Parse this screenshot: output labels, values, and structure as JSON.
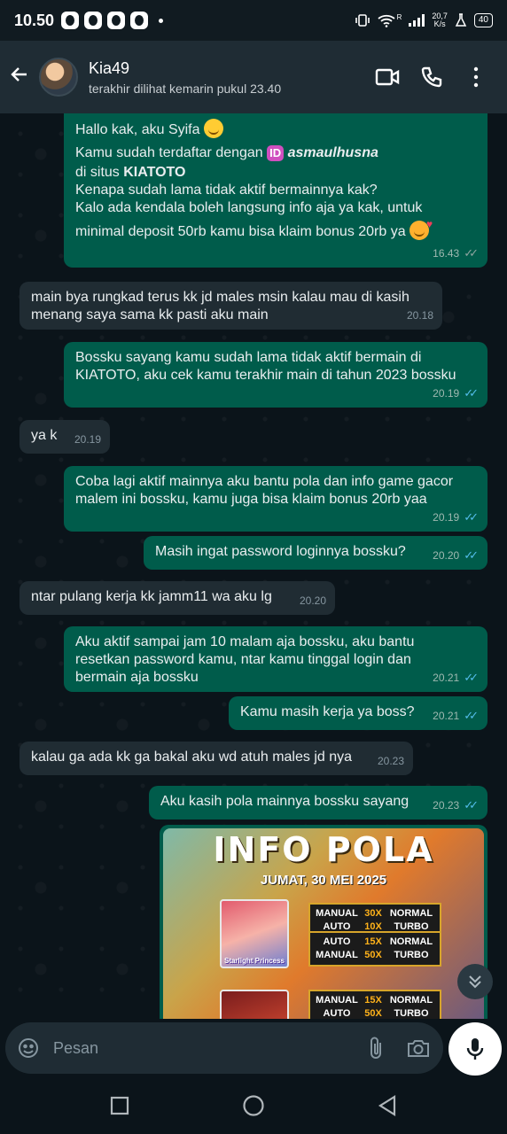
{
  "status_bar": {
    "time": "10.50",
    "network_speed": "20,7",
    "network_unit": "K/s",
    "wifi_label": "R",
    "battery": "40"
  },
  "header": {
    "contact_name": "Kia49",
    "last_seen": "terakhir dilihat kemarin pukul 23.40"
  },
  "messages": [
    {
      "direction": "out",
      "lines": [
        "Hallo kak, aku Syifa",
        "Kamu sudah terdaftar dengan",
        "asmaulhusna",
        "di situs",
        "KIATOTO",
        "Kenapa sudah lama tidak aktif bermainnya kak?",
        "Kalo ada kendala boleh langsung info aja ya kak, untuk",
        "minimal deposit 50rb kamu bisa klaim bonus 20rb ya"
      ],
      "id_tag": "ID",
      "time": "16.43",
      "read": false
    },
    {
      "direction": "in",
      "text": "main bya rungkad terus kk jd males msin kalau mau di kasih menang saya sama kk pasti aku main",
      "time": "20.18"
    },
    {
      "direction": "out",
      "text": "Bossku sayang kamu sudah lama tidak aktif bermain di KIATOTO, aku cek kamu terakhir main di tahun 2023 bossku",
      "time": "20.19",
      "read": true
    },
    {
      "direction": "in",
      "text": "ya k",
      "time": "20.19"
    },
    {
      "direction": "out",
      "text": "Coba lagi aktif mainnya aku bantu pola dan info game gacor malem ini bossku, kamu juga bisa klaim bonus 20rb yaa",
      "time": "20.19",
      "read": true
    },
    {
      "direction": "out",
      "text": "Masih ingat password loginnya bossku?",
      "time": "20.20",
      "read": true
    },
    {
      "direction": "in",
      "text": "ntar pulang kerja kk jamm11 wa aku lg",
      "time": "20.20"
    },
    {
      "direction": "out",
      "text": "Aku aktif sampai jam 10 malam aja bossku, aku bantu resetkan password kamu, ntar kamu tinggal login dan bermain aja bossku",
      "time": "20.21",
      "read": true
    },
    {
      "direction": "out",
      "text": "Kamu masih kerja ya boss?",
      "time": "20.21",
      "read": true
    },
    {
      "direction": "in",
      "text": "kalau ga ada kk ga bakal aku wd atuh males jd nya",
      "time": "20.23"
    },
    {
      "direction": "out",
      "text": "Aku kasih pola mainnya bossku sayang",
      "time": "20.23",
      "read": true
    }
  ],
  "image_message": {
    "title": "INFO POLA",
    "date": "JUMAT, 30 MEI 2025",
    "game_label": "Starlight Princess",
    "pola_rows": [
      [
        "MANUAL",
        "30X",
        "NORMAL"
      ],
      [
        "AUTO",
        "10X",
        "TURBO"
      ],
      [
        "AUTO",
        "15X",
        "NORMAL"
      ],
      [
        "MANUAL",
        "50X",
        "TURBO"
      ],
      [
        "MANUAL",
        "15X",
        "NORMAL"
      ],
      [
        "AUTO",
        "50X",
        "TURBO"
      ]
    ]
  },
  "input": {
    "placeholder": "Pesan"
  },
  "colors": {
    "outgoing_bubble": "#005c4b",
    "incoming_bubble": "#202c33",
    "read_ticks": "#53bdeb",
    "background": "#0b141a"
  }
}
